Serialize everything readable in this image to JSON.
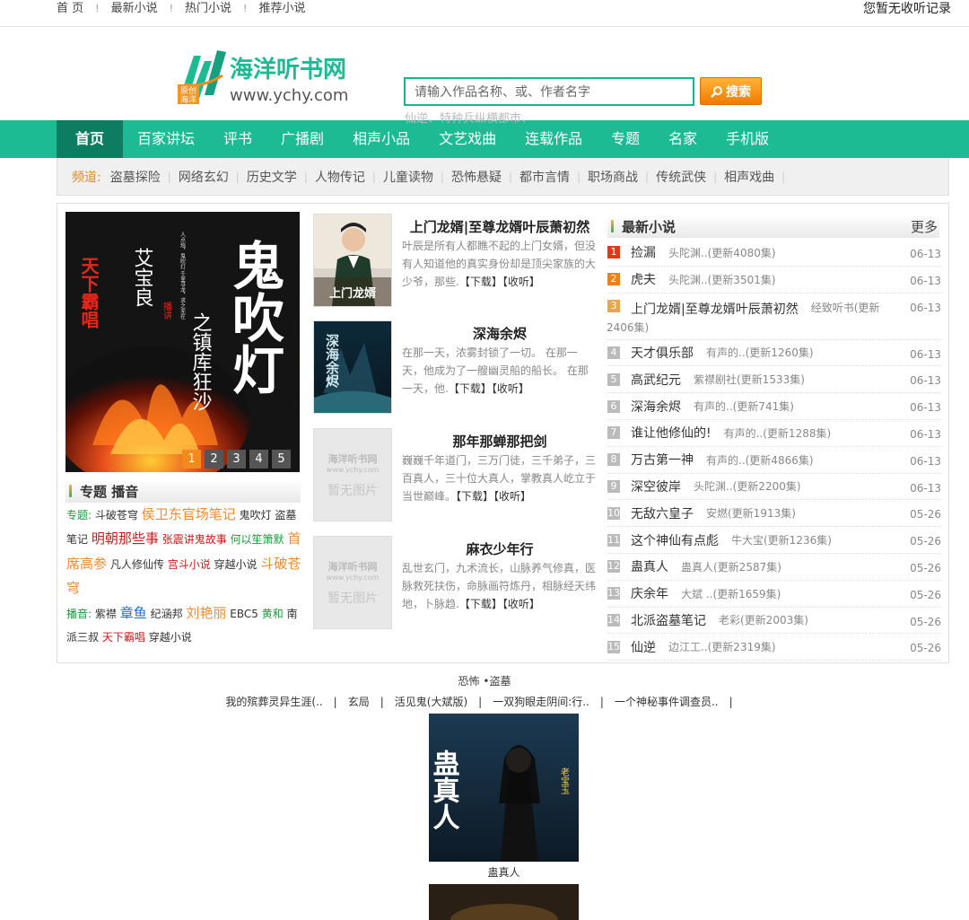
{
  "topbar": {
    "links": [
      "首 页",
      "最新小说",
      "热门小说",
      "推荐小说"
    ],
    "separator": "!",
    "history": "您暂无收听记录"
  },
  "logo": {
    "site_name": "海洋听书网",
    "url_text": "www.ychy.com",
    "badge_line1": "原创",
    "badge_line2": "海洋"
  },
  "search": {
    "placeholder": "请输入作品名称、或、作者名字",
    "button": "搜索",
    "hint": "仙逆、特种兵纵横都市、"
  },
  "nav": [
    "首页",
    "百家讲坛",
    "评书",
    "广播剧",
    "相声小品",
    "文艺戏曲",
    "连载作品",
    "专题",
    "名家",
    "手机版"
  ],
  "channel": {
    "label": "频道:",
    "items": [
      "盗墓探险",
      "网络玄幻",
      "历史文学",
      "人物传记",
      "儿童读物",
      "恐怖悬疑",
      "都市言情",
      "职场商战",
      "传统武侠",
      "相声戏曲"
    ]
  },
  "slider": {
    "cover_title": "鬼吹灯",
    "cover_sub": "之镇库狂沙",
    "cover_author": "艾宝良",
    "cover_side": "天下霸唱",
    "cover_tag": "播讲",
    "cover_blurb": "人点烛，鬼吹灯 千里寻龙，求之无在",
    "pages": [
      "1",
      "2",
      "3",
      "4",
      "5"
    ],
    "active": 0
  },
  "topics": {
    "title": "专题 播音",
    "line1": [
      {
        "t": "专题:",
        "c": "c-green"
      },
      {
        "t": "斗破苍穹",
        "c": ""
      },
      {
        "t": "侯卫东官场笔记",
        "c": "c-orange big"
      },
      {
        "t": "鬼吹灯",
        "c": ""
      },
      {
        "t": "盗墓笔记",
        "c": ""
      },
      {
        "t": "明朝那些事",
        "c": "c-red big"
      },
      {
        "t": "张震讲鬼故事",
        "c": "c-red"
      },
      {
        "t": "何以笙箫默",
        "c": "c-green"
      },
      {
        "t": "首席高参",
        "c": "c-orange big"
      },
      {
        "t": "凡人修仙传",
        "c": ""
      },
      {
        "t": "宫斗小说",
        "c": "c-red"
      },
      {
        "t": "穿越小说",
        "c": ""
      },
      {
        "t": "斗破苍穹",
        "c": "c-orange big"
      }
    ],
    "line2": [
      {
        "t": "播音:",
        "c": "c-green"
      },
      {
        "t": "紫襟",
        "c": ""
      },
      {
        "t": "章鱼",
        "c": "c-blue big"
      },
      {
        "t": "纪涵邦",
        "c": ""
      },
      {
        "t": "刘艳丽",
        "c": "c-orange big"
      },
      {
        "t": "EBC5",
        "c": ""
      },
      {
        "t": "黄和",
        "c": "c-green"
      },
      {
        "t": "南派三叔",
        "c": ""
      },
      {
        "t": "天下霸唱",
        "c": "c-red"
      },
      {
        "t": "穿越小说",
        "c": ""
      }
    ]
  },
  "books": [
    {
      "title": "上门龙婿|至尊龙婿叶辰萧初然",
      "desc": "叶辰是所有人都瞧不起的上门女婿，但没有人知道他的真实身份却是顶尖家族的大少爷，那些.",
      "cover": "上门龙婿",
      "has_cover": true
    },
    {
      "title": "深海余烬",
      "desc": "在那一天，浓雾封锁了一切。 在那一天，他成为了一艘幽灵船的船长。 在那一天，他.",
      "cover": "深海余烬",
      "has_cover": true
    },
    {
      "title": "那年那蝉那把剑",
      "desc": "巍巍千年道门，三万门徒，三千弟子，三百真人，三十位大真人，掌教真人屹立于当世巅峰。",
      "cover": "",
      "has_cover": false
    },
    {
      "title": "麻衣少年行",
      "desc": "乱世玄门，九术流长，山脉养气修真，医脉救死扶伤，命脉画符炼丹，相脉经天纬地，卜脉趋.",
      "cover": "",
      "has_cover": false
    }
  ],
  "book_actions": {
    "download": "【下载】",
    "listen": "【收听】"
  },
  "nocover": {
    "line1": "海洋听书网",
    "line2": "www.ychy.com",
    "line3": "暂无图片"
  },
  "latest": {
    "title": "最新小说",
    "more": "更多",
    "rows": [
      {
        "n": "1",
        "t": "捡漏",
        "a": "头陀渊..(更新4080集)",
        "d": "06-13"
      },
      {
        "n": "2",
        "t": "虎夫",
        "a": "头陀渊..(更新3501集)",
        "d": "06-13"
      },
      {
        "n": "3",
        "t": "上门龙婿|至尊龙婿叶辰萧初然",
        "a": "经致听书(更新",
        "a2": "2406集)",
        "d": "06-13"
      },
      {
        "n": "4",
        "t": "天才俱乐部",
        "a": "有声的..(更新1260集)",
        "d": "06-13"
      },
      {
        "n": "5",
        "t": "高武纪元",
        "a": "紫襟剧社(更新1533集)",
        "d": "06-13"
      },
      {
        "n": "6",
        "t": "深海余烬",
        "a": "有声的..(更新741集)",
        "d": "06-13"
      },
      {
        "n": "7",
        "t": "谁让他修仙的!",
        "a": "有声的..(更新1288集)",
        "d": "06-13"
      },
      {
        "n": "8",
        "t": "万古第一神",
        "a": "有声的..(更新4866集)",
        "d": "06-13"
      },
      {
        "n": "9",
        "t": "深空彼岸",
        "a": "头陀渊..(更新2200集)",
        "d": "06-13"
      },
      {
        "n": "10",
        "t": "无敌六皇子",
        "a": "安燃(更新1913集)",
        "d": "05-26"
      },
      {
        "n": "11",
        "t": "这个神仙有点彪",
        "a": "牛大宝(更新1236集)",
        "d": "05-26"
      },
      {
        "n": "12",
        "t": "蛊真人",
        "a": "蛊真人(更新2587集)",
        "d": "05-26"
      },
      {
        "n": "13",
        "t": "庆余年",
        "a": "大斌 ..(更新1659集)",
        "d": "05-26"
      },
      {
        "n": "14",
        "t": "北派盗墓笔记",
        "a": "老彩(更新2003集)",
        "d": "05-26"
      },
      {
        "n": "15",
        "t": "仙逆",
        "a": "边江工..(更新2319集)",
        "d": "05-26"
      }
    ]
  },
  "hot": {
    "category": "恐怖 •盗墓",
    "links": [
      "我的殡葬灵异生涯(..",
      "玄局",
      "活见鬼(大斌版)",
      "一双狗眼走阴间:行..",
      "一个神秘事件调查员.."
    ],
    "sep": "|",
    "featured_cover": "蛊真人",
    "featured_badge": "老宝玉",
    "featured_name": "蛊真人"
  },
  "colors": {
    "accent": "#1dbb94",
    "nav_active": "#0d7d61",
    "search_btn": "#f07c00"
  }
}
